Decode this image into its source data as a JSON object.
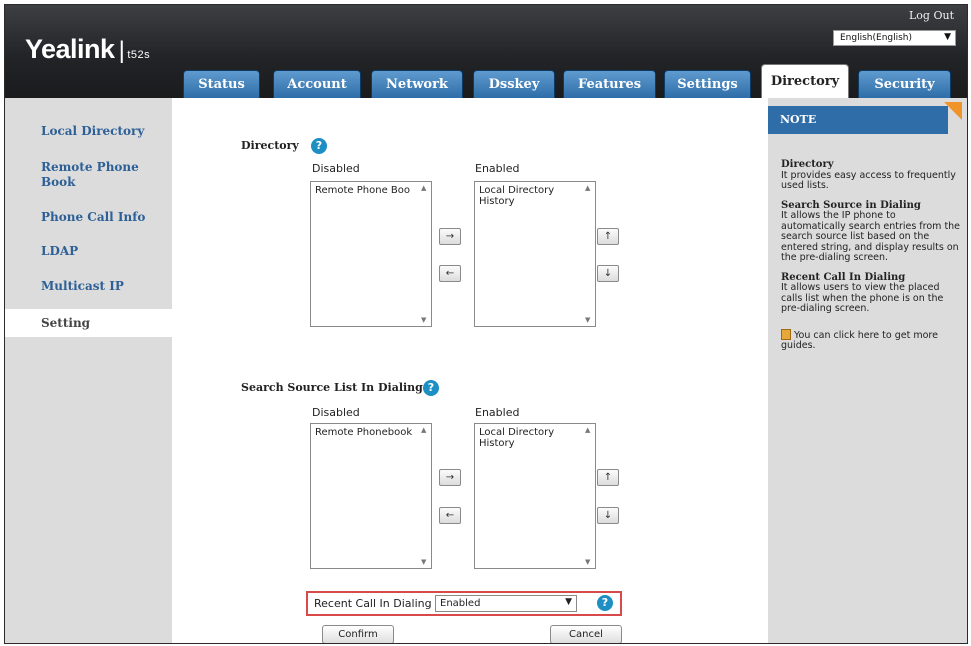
{
  "header": {
    "brand": "Yealink",
    "model": "t52s",
    "logout_label": "Log Out",
    "language_selected": "English(English)"
  },
  "tabs": [
    {
      "label": "Status"
    },
    {
      "label": "Account"
    },
    {
      "label": "Network"
    },
    {
      "label": "Dsskey"
    },
    {
      "label": "Features"
    },
    {
      "label": "Settings"
    },
    {
      "label": "Directory",
      "active": true
    },
    {
      "label": "Security"
    }
  ],
  "sidebar": {
    "items": [
      {
        "label": "Local Directory"
      },
      {
        "label": "Remote Phone Book"
      },
      {
        "label": "Phone Call Info"
      },
      {
        "label": "LDAP"
      },
      {
        "label": "Multicast IP"
      },
      {
        "label": "Setting",
        "active": true
      }
    ]
  },
  "main": {
    "directory": {
      "title": "Directory",
      "disabled_label": "Disabled",
      "enabled_label": "Enabled",
      "disabled_items": [
        "Remote Phone Boo"
      ],
      "enabled_items": [
        "Local Directory",
        "History"
      ]
    },
    "search_source": {
      "title": "Search Source List In Dialing",
      "disabled_label": "Disabled",
      "enabled_label": "Enabled",
      "disabled_items": [
        "Remote Phonebook"
      ],
      "enabled_items": [
        "Local Directory",
        "History"
      ]
    },
    "recent_call": {
      "label": "Recent Call In Dialing",
      "value": "Enabled"
    },
    "confirm_label": "Confirm",
    "cancel_label": "Cancel",
    "move_right_glyph": "→",
    "move_left_glyph": "←",
    "move_up_glyph": "↑",
    "move_down_glyph": "↓"
  },
  "note": {
    "title": "NOTE",
    "sections": [
      {
        "title": "Directory",
        "text": "It provides easy access to frequently used lists."
      },
      {
        "title": "Search Source in Dialing",
        "text": "It allows the IP phone to automatically search entries from the search source list based on the entered string, and display results on the pre-dialing screen."
      },
      {
        "title": "Recent Call In Dialing",
        "text": "It allows users to view the placed calls list when the phone is on the pre-dialing screen."
      }
    ],
    "guide_text": "You can click here to get more guides."
  },
  "colors": {
    "tab_blue": "#2e6da8",
    "sidebar_bg": "#dcdcdc",
    "sidebar_link": "#2d6096",
    "highlight_border": "#d84a4a",
    "note_corner": "#f0942a",
    "help_icon": "#1e8fc2"
  }
}
